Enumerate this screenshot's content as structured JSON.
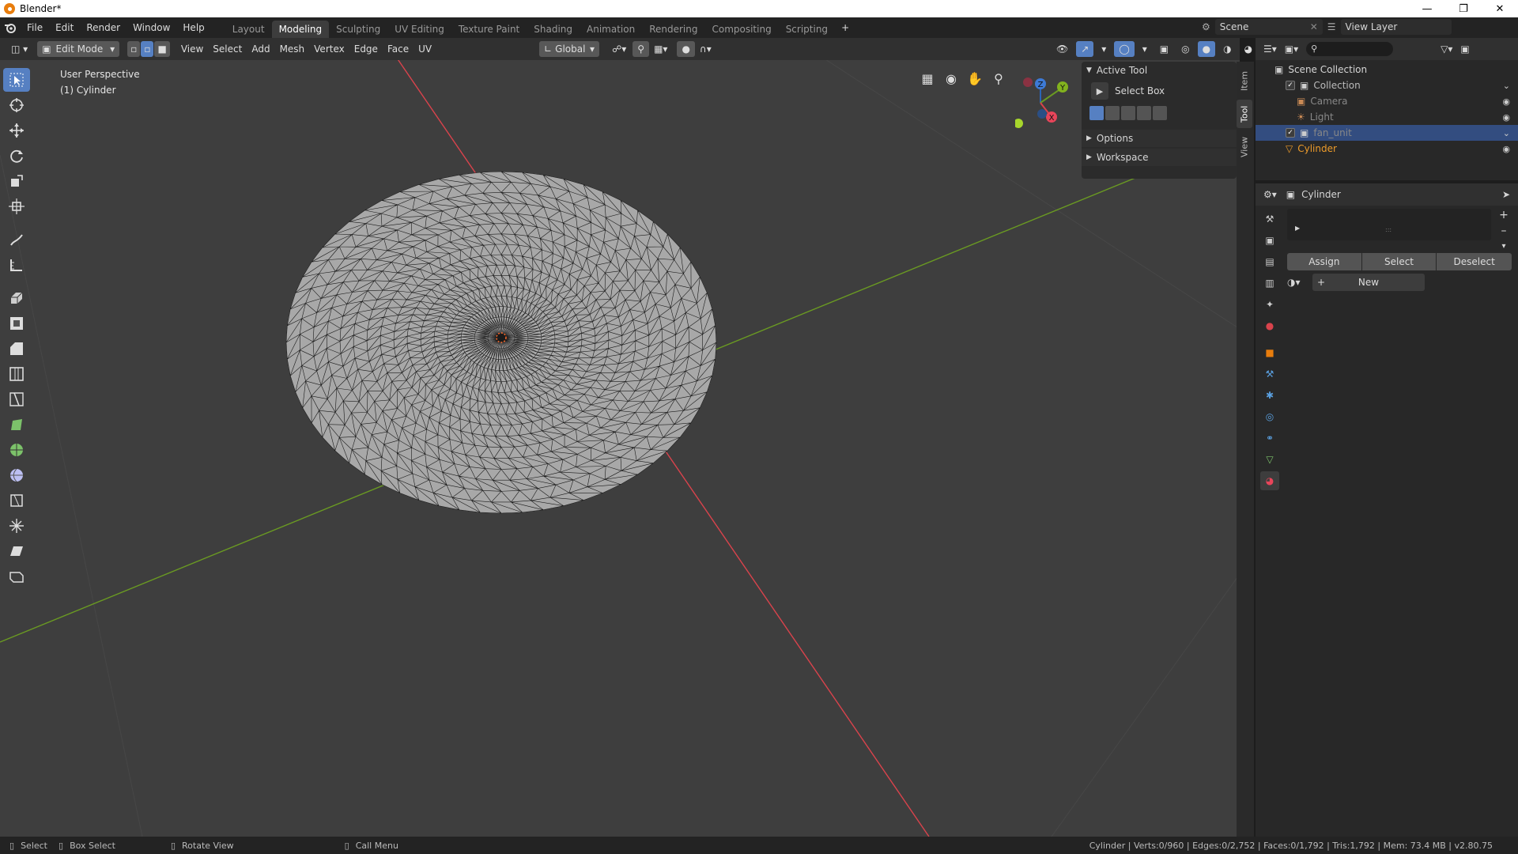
{
  "window": {
    "title": "Blender*",
    "minimize_icon": "minimize-icon",
    "maximize_icon": "restore-icon",
    "close_icon": "close-icon"
  },
  "menus": [
    "File",
    "Edit",
    "Render",
    "Window",
    "Help"
  ],
  "workspace_tabs": [
    "Layout",
    "Modeling",
    "Sculpting",
    "UV Editing",
    "Texture Paint",
    "Shading",
    "Animation",
    "Rendering",
    "Compositing",
    "Scripting"
  ],
  "active_workspace": "Modeling",
  "scene": {
    "label": "Scene",
    "view_layer": "View Layer"
  },
  "viewport_header": {
    "mode": "Edit Mode",
    "menus": [
      "View",
      "Select",
      "Add",
      "Mesh",
      "Vertex",
      "Edge",
      "Face",
      "UV"
    ],
    "transform_orientation": "Global"
  },
  "viewport": {
    "perspective": "User Perspective",
    "object": "(1) Cylinder"
  },
  "gizmo": {
    "x": "X",
    "y": "Y",
    "z": "Z"
  },
  "npanel": {
    "active_tool_label": "Active Tool",
    "tool_name": "Select Box",
    "options_label": "Options",
    "workspace_label": "Workspace",
    "tabs": [
      "Item",
      "Tool",
      "View"
    ],
    "active_tab": "Tool"
  },
  "outliner": {
    "root": "Scene Collection",
    "items": [
      {
        "name": "Collection",
        "indent": 1
      },
      {
        "name": "Camera",
        "indent": 2
      },
      {
        "name": "Light",
        "indent": 2
      },
      {
        "name": "fan_unit",
        "indent": 1
      },
      {
        "name": "Cylinder",
        "indent": 1
      }
    ]
  },
  "properties": {
    "object_name": "Cylinder",
    "assign_label": "Assign",
    "select_label": "Select",
    "deselect_label": "Deselect",
    "new_label": "New"
  },
  "status": {
    "select": "Select",
    "box_select": "Box Select",
    "rotate_view": "Rotate View",
    "call_menu": "Call Menu",
    "stats": "Cylinder | Verts:0/960 | Edges:0/2,752 | Faces:0/1,792 | Tris:1,792 | Mem: 73.4 MB | v2.80.75"
  },
  "colors": {
    "accent": "#5680c2",
    "x_axis": "#d9434c",
    "y_axis": "#6a9a22",
    "mesh_fill": "#a8a8a8",
    "active_object": "#ed9b2a"
  }
}
